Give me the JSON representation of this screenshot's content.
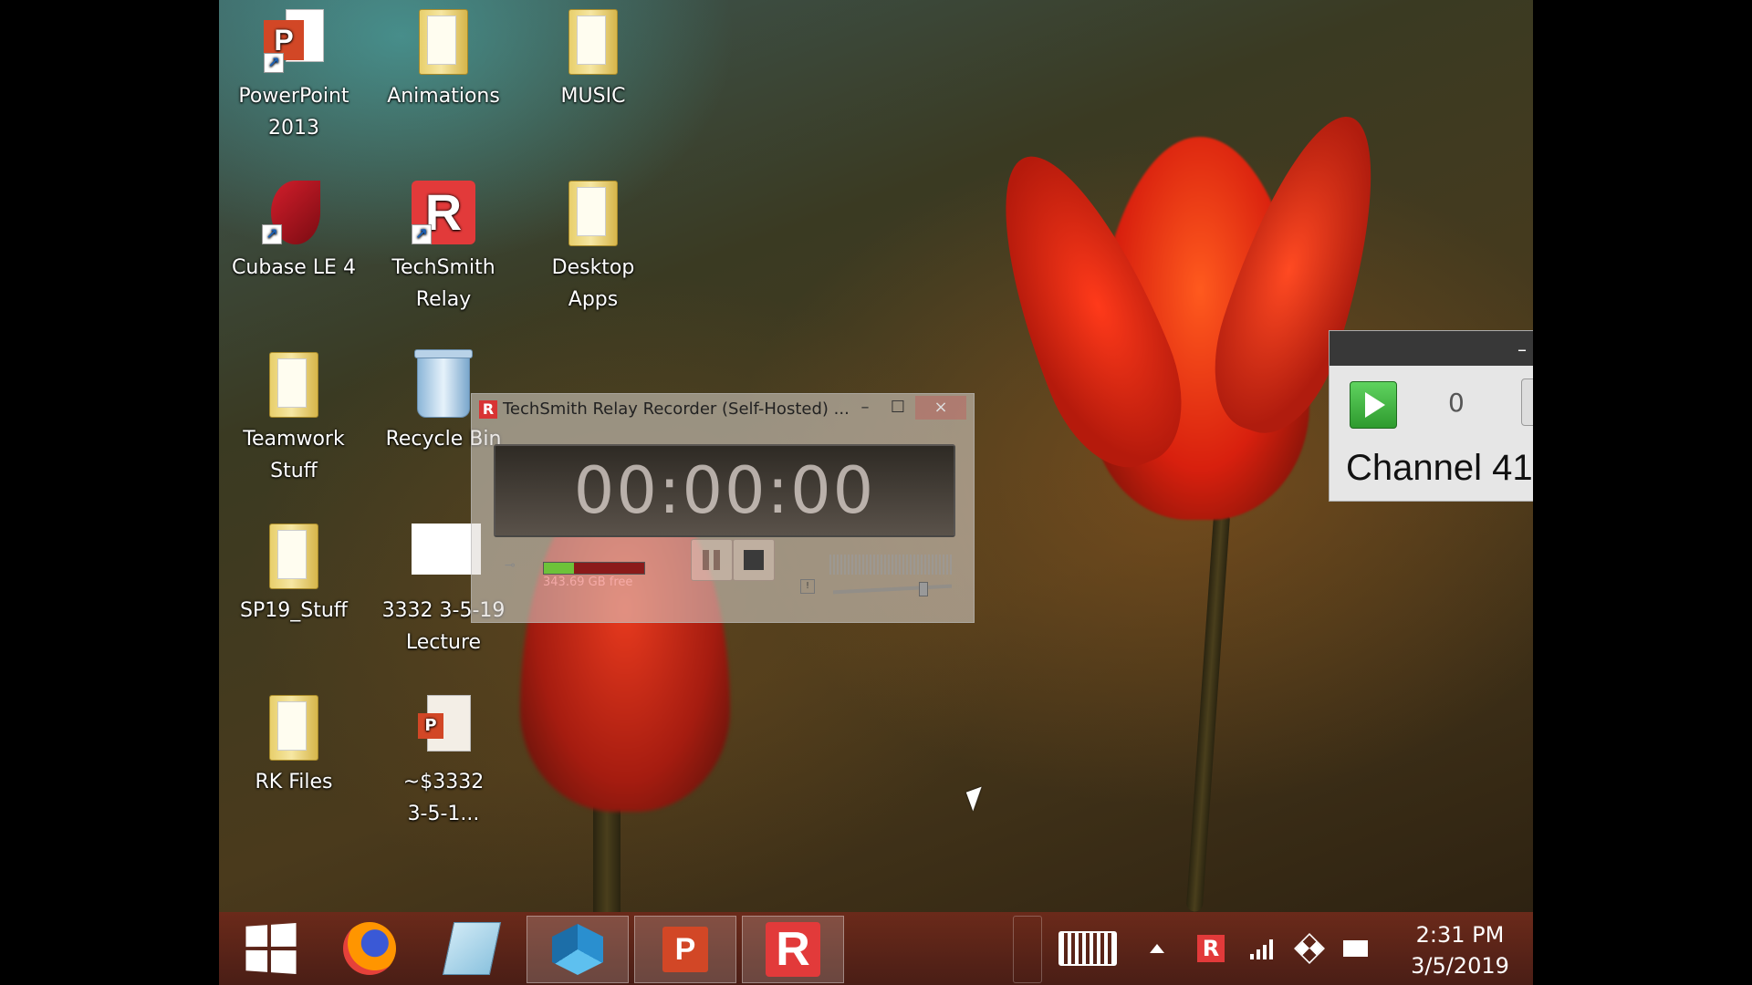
{
  "desktop_icons": [
    {
      "label": "PowerPoint\n2013"
    },
    {
      "label": "Animations"
    },
    {
      "label": "MUSIC"
    },
    {
      "label": "Cubase LE 4"
    },
    {
      "label": "TechSmith\nRelay"
    },
    {
      "label": "Desktop\nApps"
    },
    {
      "label": "Teamwork\nStuff"
    },
    {
      "label": "Recycle Bin"
    },
    {
      "label": "SP19_Stuff"
    },
    {
      "label": "3332 3-5-19\nLecture"
    },
    {
      "label": "RK Files"
    },
    {
      "label": "~$3332\n3-5-1..."
    }
  ],
  "recorder": {
    "title": "TechSmith Relay Recorder (Self-Hosted) ...",
    "logo_letter": "R",
    "minimize": "–",
    "maximize": "☐",
    "close": "×",
    "timer": "00:00:00",
    "disk_free": "343.69 GB free",
    "level_fraction": 0.3
  },
  "channel_panel": {
    "minimize": "–",
    "counter": "0",
    "name": "Channel 41"
  },
  "taskbar": {
    "ppt_letter": "P",
    "relay_letter": "R",
    "tray_relay_letter": "R"
  },
  "clock": {
    "time": "2:31 PM",
    "date": "3/5/2019"
  },
  "colors": {
    "taskbar": "#5a2418",
    "powerpoint": "#d24726",
    "relay": "#e23a3a",
    "play_green": "#3fb33f"
  }
}
